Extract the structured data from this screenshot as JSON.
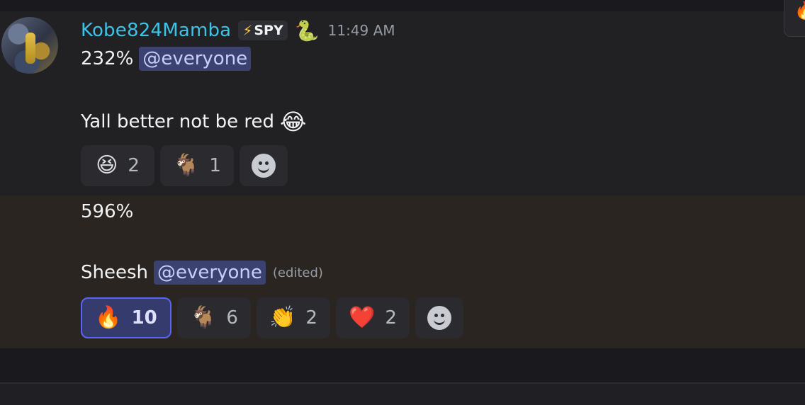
{
  "message1": {
    "username": "Kobe824Mamba",
    "tag": {
      "icon": "lightning-bolt-icon",
      "glyph": "⚡",
      "label": "SPY"
    },
    "badge_emoji": "🐍",
    "timestamp": "11:49 AM",
    "line1": {
      "text": "232%",
      "mention": "@everyone"
    },
    "line2": {
      "text": "Yall better not be red",
      "emoji": "😂"
    },
    "reactions": [
      {
        "emoji": "😆",
        "count": "2",
        "icon": "laughing-face-icon"
      },
      {
        "emoji": "🐐",
        "count": "1",
        "icon": "goat-icon"
      }
    ],
    "add_reaction_icon": "smiley-add-reaction-icon"
  },
  "message2": {
    "line1": {
      "text": "596%"
    },
    "line2": {
      "text": "Sheesh",
      "mention": "@everyone",
      "edited": "(edited)"
    },
    "reactions": [
      {
        "emoji": "🔥",
        "count": "10",
        "active": true,
        "icon": "fire-icon"
      },
      {
        "emoji": "🐐",
        "count": "6",
        "icon": "goat-icon"
      },
      {
        "emoji": "👏",
        "count": "2",
        "icon": "clapping-hands-icon"
      },
      {
        "emoji": "❤️",
        "count": "2",
        "icon": "heart-icon"
      }
    ],
    "add_reaction_icon": "smiley-add-reaction-icon"
  },
  "corner_popover": {
    "emoji": "🔥",
    "icon": "fire-icon"
  },
  "colors": {
    "username": "#3dc3e6",
    "mention_bg": "#3c4270",
    "active_reaction_border": "#5865f2",
    "highlight_bg": "#2a2520"
  }
}
